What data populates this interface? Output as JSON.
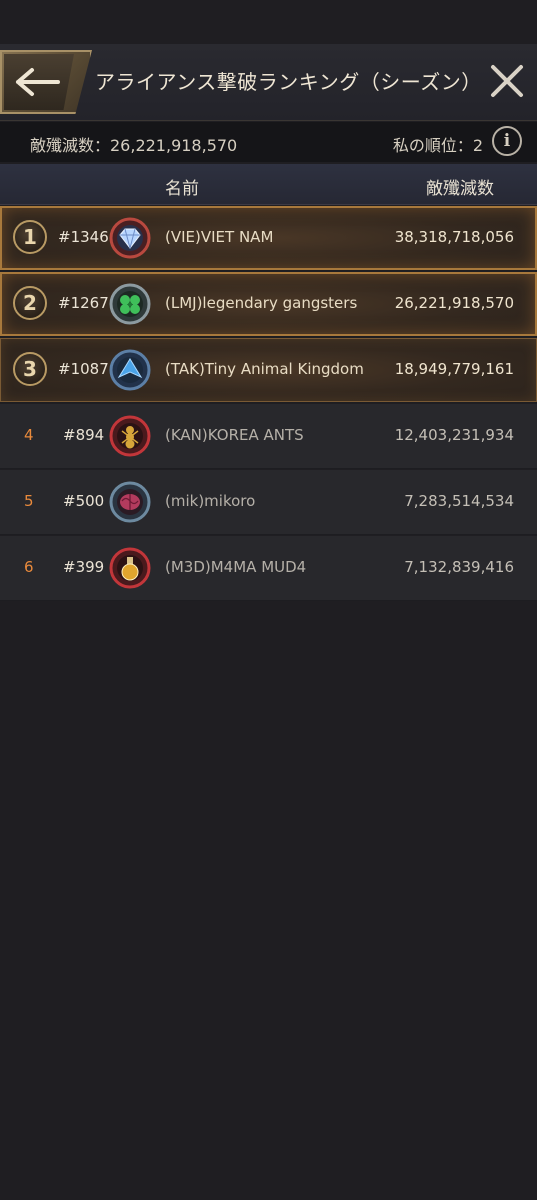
{
  "header": {
    "title": "アライアンス撃破ランキング（シーズン）",
    "back_icon": "arrow-left-icon",
    "close_icon": "close-icon"
  },
  "summary": {
    "kills_text": "敵殲滅数：26,221,918,570",
    "my_rank_text": "私の順位：2",
    "info_label": "i"
  },
  "columns": {
    "name": "名前",
    "kills": "敵殲滅数"
  },
  "rows": [
    {
      "rank": "1",
      "tag": "#1346",
      "name": "(VIE)VIET NAM",
      "kills": "38,318,718,056",
      "emblem": "diamond-emblem-icon"
    },
    {
      "rank": "2",
      "tag": "#1267",
      "name": "(LMJ)legendary gangsters",
      "kills": "26,221,918,570",
      "emblem": "clover-emblem-icon"
    },
    {
      "rank": "3",
      "tag": "#1087",
      "name": "(TAK)Tiny Animal Kingdom",
      "kills": "18,949,779,161",
      "emblem": "blue-bird-emblem-icon"
    },
    {
      "rank": "4",
      "tag": "#894",
      "name": "(KAN)KOREA ANTS",
      "kills": "12,403,231,934",
      "emblem": "ant-emblem-icon"
    },
    {
      "rank": "5",
      "tag": "#500",
      "name": "(mik)mikoro",
      "kills": "7,283,514,534",
      "emblem": "brain-emblem-icon"
    },
    {
      "rank": "6",
      "tag": "#399",
      "name": "(M3D)M4MA MUD4",
      "kills": "7,132,839,416",
      "emblem": "potion-emblem-icon"
    }
  ],
  "colors": {
    "background": "#1f1e22",
    "accent_gold": "#b89a64",
    "rank_orange": "#e98a3c"
  }
}
